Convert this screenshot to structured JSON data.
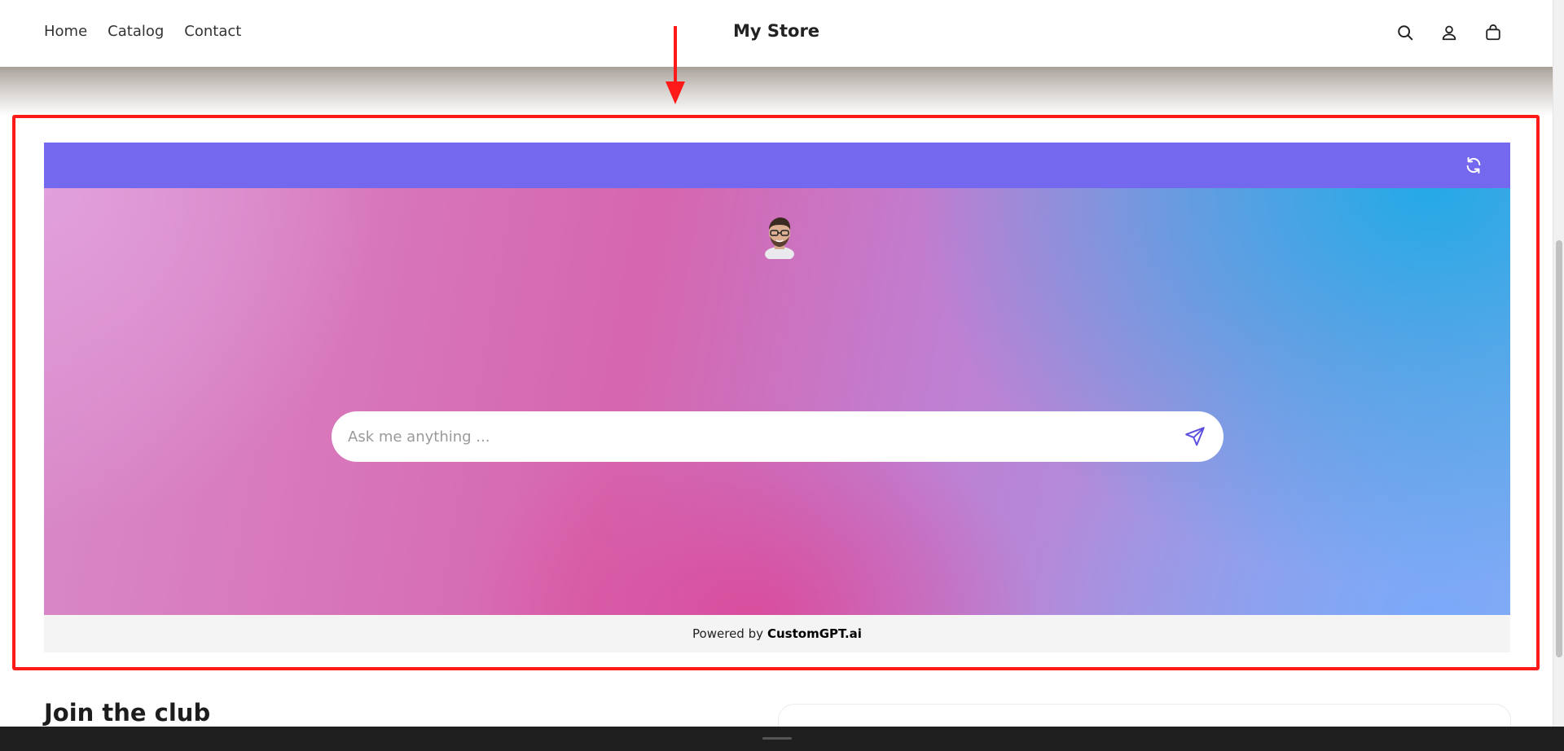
{
  "header": {
    "nav": [
      "Home",
      "Catalog",
      "Contact"
    ],
    "brand": "My Store",
    "icons": [
      "search-icon",
      "account-icon",
      "cart-icon"
    ]
  },
  "widget": {
    "refresh_icon": "refresh-icon",
    "avatar": "assistant-avatar",
    "input_placeholder": "Ask me anything ...",
    "send_icon": "send-icon",
    "footer_prefix": "Powered by",
    "footer_brand": "CustomGPT.ai",
    "colors": {
      "top_bar": "#7468ef",
      "annotation": "#ff1a1a"
    }
  },
  "sections": {
    "newsletter_title": "Join the club"
  }
}
